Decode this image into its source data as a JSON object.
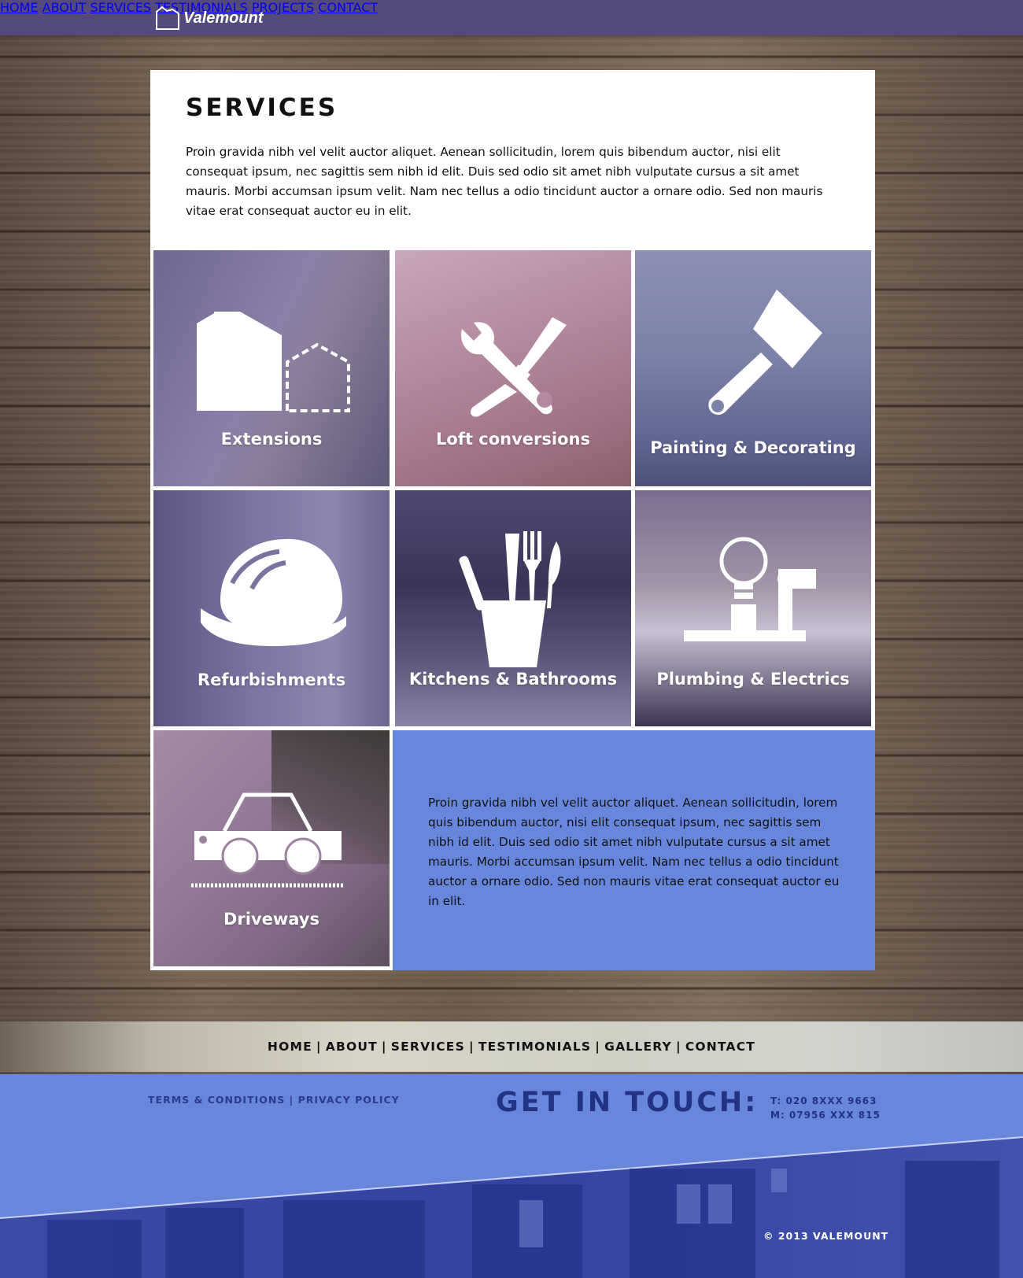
{
  "header": {
    "brand": "Valemount",
    "nav": [
      "HOME",
      "ABOUT",
      "SERVICES",
      "TESTIMONIALS",
      "PROJECTS",
      "CONTACT"
    ]
  },
  "services": {
    "title": "SERVICES",
    "intro": "Proin gravida nibh vel velit auctor aliquet. Aenean sollicitudin, lorem quis bibendum auctor, nisi elit consequat ipsum, nec sagittis sem nibh id elit. Duis sed odio sit amet nibh vulputate cursus a sit amet mauris. Morbi accumsan ipsum velit. Nam nec tellus a odio tincidunt auctor a ornare odio. Sed non mauris vitae erat consequat auctor eu in elit.",
    "tiles": [
      {
        "label": "Extensions",
        "icon": "house-extension-icon"
      },
      {
        "label": "Loft conversions",
        "icon": "wrench-screwdriver-icon"
      },
      {
        "label": "Painting & Decorating",
        "icon": "paintbrush-icon"
      },
      {
        "label": "Refurbishments",
        "icon": "hard-hat-icon"
      },
      {
        "label": "Kitchens & Bathrooms",
        "icon": "utensils-cup-icon"
      },
      {
        "label": "Plumbing & Electrics",
        "icon": "lightbulb-pipe-icon"
      },
      {
        "label": "Driveways",
        "icon": "car-icon"
      }
    ],
    "blurb": "Proin gravida nibh vel velit auctor aliquet. Aenean sollicitudin, lorem quis bibendum auctor, nisi elit consequat ipsum, nec sagittis sem nibh id elit. Duis sed odio sit amet nibh vulputate cursus a sit amet mauris. Morbi accumsan ipsum velit. Nam nec tellus a odio tincidunt auctor a ornare odio. Sed non  mauris vitae erat consequat auctor eu in elit."
  },
  "footer_nav": [
    "HOME",
    "ABOUT",
    "SERVICES",
    "TESTIMONIALS",
    "GALLERY",
    "CONTACT"
  ],
  "footer": {
    "terms": "TERMS & CONDITIONS",
    "privacy": "PRIVACY POLICY",
    "get_in_touch": "GET IN TOUCH:",
    "phone": "T: 020 8XXX 9663",
    "mobile": "M: 07956 XXX 815",
    "copyright": "© 2013 VALEMOUNT"
  },
  "colors": {
    "nav_bar": "#554a7c",
    "accent_blue": "#6787dc",
    "footer_text": "#233384"
  }
}
